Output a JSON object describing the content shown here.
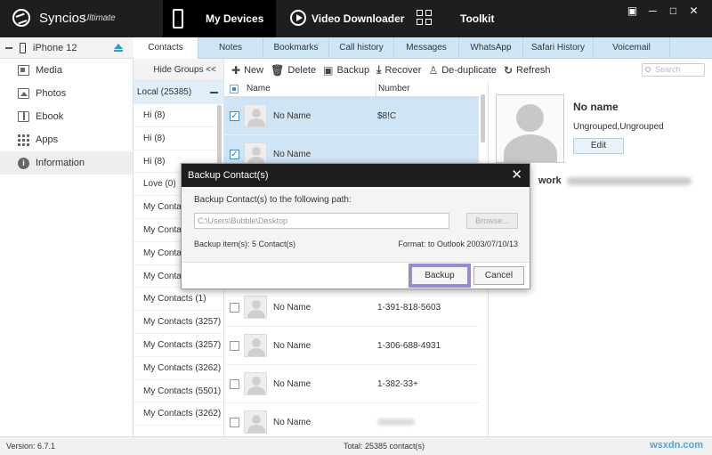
{
  "app": {
    "brand": "Syncios",
    "brand_sub": "Ultimate",
    "nav": [
      "My Devices",
      "Video Downloader",
      "Toolkit"
    ],
    "window_buttons": [
      "▣",
      "─",
      "□",
      "✕"
    ]
  },
  "device": {
    "name": "iPhone 12"
  },
  "sidebar": {
    "items": [
      {
        "label": "Media",
        "icon": "media-icon"
      },
      {
        "label": "Photos",
        "icon": "photos-icon"
      },
      {
        "label": "Ebook",
        "icon": "ebook-icon"
      },
      {
        "label": "Apps",
        "icon": "apps-icon"
      },
      {
        "label": "Information",
        "icon": "information-icon",
        "active": true
      }
    ]
  },
  "tabs": [
    {
      "label": "Contacts",
      "active": true
    },
    {
      "label": "Notes"
    },
    {
      "label": "Bookmarks"
    },
    {
      "label": "Call history"
    },
    {
      "label": "Messages"
    },
    {
      "label": "WhatsApp"
    },
    {
      "label": "Safari History"
    },
    {
      "label": "Voicemail"
    }
  ],
  "groups": {
    "hide_label": "Hide Groups <<",
    "local": "Local (25385)",
    "items": [
      "Hi (8)",
      "Hi (8)",
      "Hi (8)",
      "Love (0)",
      "My Contacts",
      "My Contacts",
      "My Contacts",
      "My Contacts",
      "My Contacts (1)",
      "My Contacts (3257)",
      "My Contacts (3257)",
      "My Contacts (3262)",
      "My Contacts (5501)",
      "My Contacts (3262)"
    ]
  },
  "toolbar": {
    "new": "New",
    "delete": "Delete",
    "backup": "Backup",
    "recover": "Recover",
    "dedupe": "De-duplicate",
    "refresh": "Refresh",
    "search_placeholder": "Search"
  },
  "list": {
    "col_name": "Name",
    "col_number": "Number",
    "rows": [
      {
        "name": "No Name",
        "number": "$8!C",
        "checked": true,
        "selected": true
      },
      {
        "name": "No Name",
        "number": "",
        "checked": true,
        "selected": true
      },
      {
        "name": "No Name",
        "number": "1-391-818-5603",
        "checked": false
      },
      {
        "name": "No Name",
        "number": "1-306-688-4931",
        "checked": false
      },
      {
        "name": "No Name",
        "number": "1-382-33+",
        "checked": false
      },
      {
        "name": "No Name",
        "number": "",
        "checked": false
      }
    ]
  },
  "detail": {
    "name": "No name",
    "groups": "Ungrouped,Ungrouped",
    "edit": "Edit",
    "work_label": "work"
  },
  "dialog": {
    "title": "Backup Contact(s)",
    "close": "✕",
    "label": "Backup Contact(s) to the following path:",
    "path": "C:\\Users\\Bubble\\Desktop",
    "browse": "Browse...",
    "items": "Backup item(s): 5 Contact(s)",
    "format": "Format: to Outlook 2003/07/10/13",
    "backup_btn": "Backup",
    "cancel_btn": "Cancel"
  },
  "status": {
    "version": "Version: 6.7.1",
    "total": "Total: 25385 contact(s)",
    "watermark": "wsxdn.com"
  }
}
